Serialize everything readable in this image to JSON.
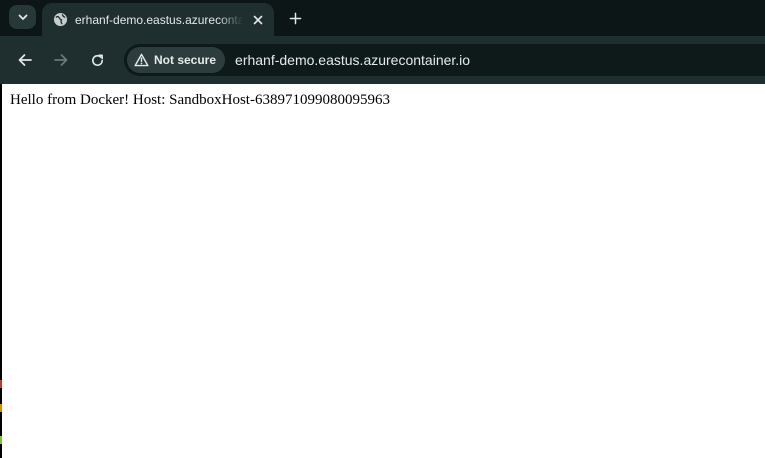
{
  "browser": {
    "tab": {
      "title": "erhanf-demo.eastus.azurecontainer.io",
      "favicon": "globe-icon"
    },
    "toolbar": {
      "security_chip": "Not secure",
      "url": "erhanf-demo.eastus.azurecontainer.io"
    },
    "icons": {
      "tab_search": "chevron-down-icon",
      "tab_close": "close-icon",
      "new_tab": "plus-icon",
      "back": "back-arrow-icon",
      "forward": "forward-arrow-icon",
      "reload": "reload-icon",
      "security": "warning-triangle-icon"
    }
  },
  "page": {
    "body_text": "Hello from Docker! Host: SandboxHost-638971099080095963"
  },
  "colors": {
    "tabstrip_bg": "#0c1616",
    "toolbar_bg": "#1f2f2f",
    "omnibox_bg": "#0e1a1a",
    "page_bg": "#ffffff"
  }
}
